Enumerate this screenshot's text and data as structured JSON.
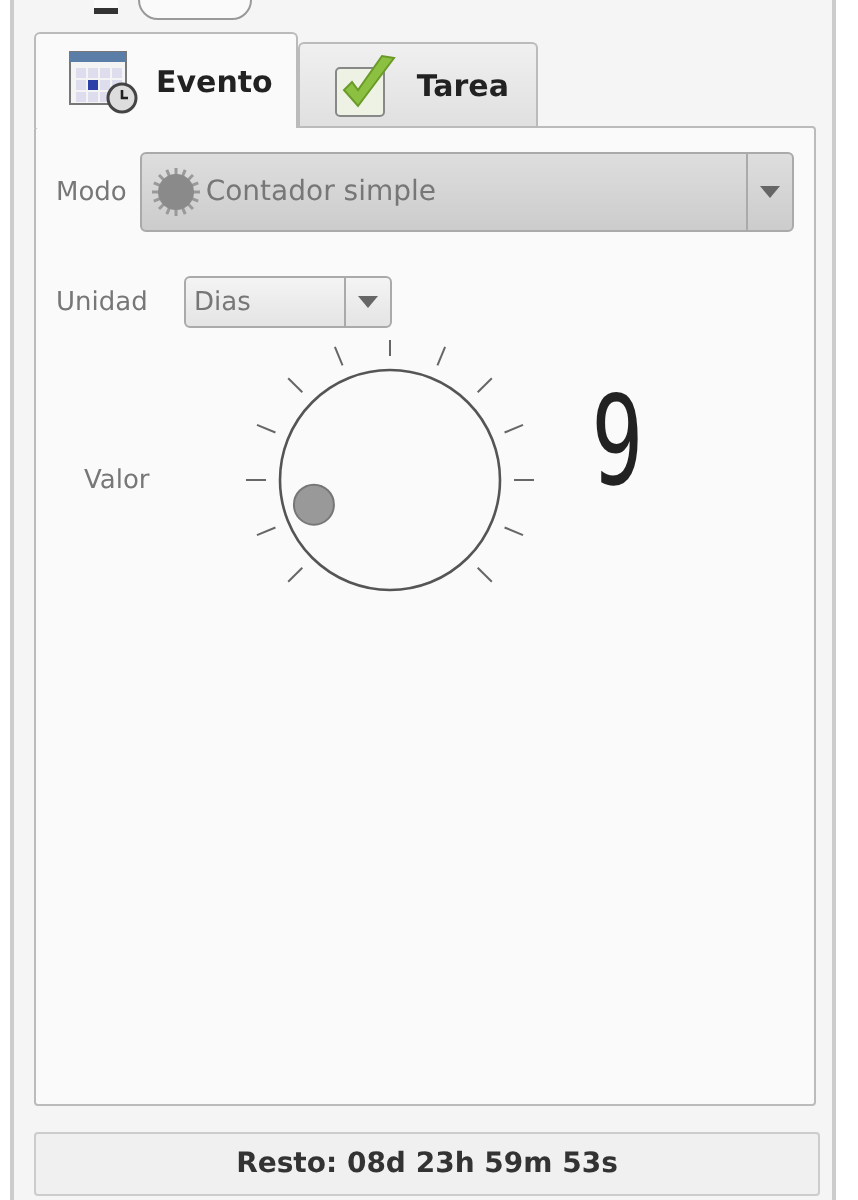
{
  "tabs": [
    {
      "label": "Evento",
      "selected": true
    },
    {
      "label": "Tarea",
      "selected": false
    }
  ],
  "mode": {
    "label": "Modo",
    "value": "Contador simple",
    "disabled": true
  },
  "unit": {
    "label": "Unidad",
    "value": "Dias"
  },
  "dial": {
    "label": "Valor",
    "reading": "9"
  },
  "status": "Resto: 08d 23h 59m 53s"
}
